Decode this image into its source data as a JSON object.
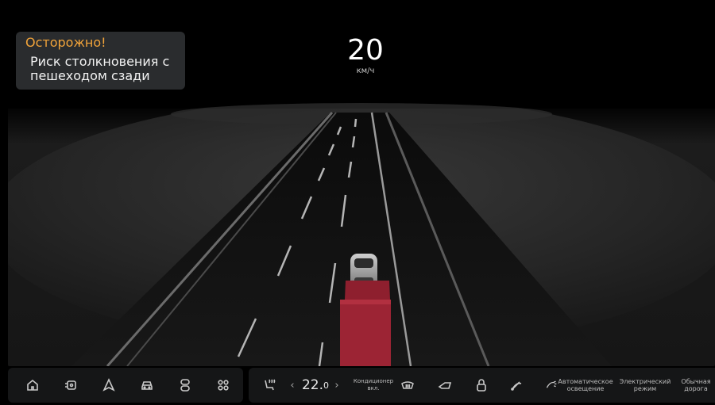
{
  "alert": {
    "title": "Осторожно!",
    "message": "Риск столкновения с пешеходом сзади",
    "title_color": "#f2a43a"
  },
  "speed": {
    "value": "20",
    "unit": "км/ч"
  },
  "dock_left": {
    "items": [
      {
        "icon": "home-icon"
      },
      {
        "icon": "camera-icon"
      },
      {
        "icon": "navigation-icon"
      },
      {
        "icon": "car-icon"
      },
      {
        "icon": "controls-icon"
      },
      {
        "icon": "apps-grid-icon"
      }
    ]
  },
  "climate": {
    "seat_icon": "seat-heat-icon",
    "temperature_main": "22.",
    "temperature_decimal": "0",
    "dec_label": "‹",
    "inc_label": "›",
    "ac_label_line1": "Кондиционер",
    "ac_label_line2": "вкл.",
    "defrost_icon": "rear-defrost-icon"
  },
  "dock_right": {
    "auto_light_line1": "Автоматическое",
    "auto_light_line2": "освещение",
    "electric_line1": "Электрический",
    "electric_line2": "режим",
    "normal_road_line1": "Обычная",
    "normal_road_line2": "дорога"
  },
  "colors": {
    "vehicle_highlight": "#b0283a",
    "panel_bg": "#2a2c2e",
    "dock_bg": "#151617"
  }
}
